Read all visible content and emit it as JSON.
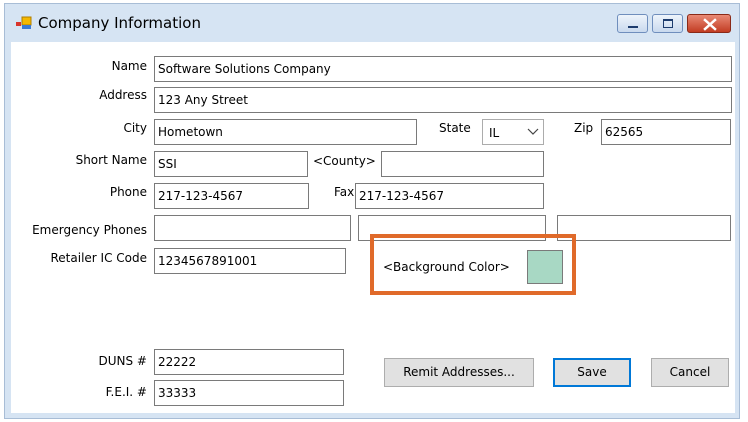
{
  "window": {
    "title": "Company Information",
    "icon": "form-app-icon",
    "controls": {
      "minimize": "minimize-icon",
      "maximize": "maximize-icon",
      "close": "close-icon"
    }
  },
  "form": {
    "name": {
      "label": "Name",
      "value": "Software Solutions Company"
    },
    "address": {
      "label": "Address",
      "value": "123 Any Street"
    },
    "city": {
      "label": "City",
      "value": "Hometown"
    },
    "state": {
      "label": "State",
      "value": "IL"
    },
    "zip": {
      "label": "Zip",
      "value": "62565"
    },
    "short_name": {
      "label": "Short Name",
      "value": "SSI"
    },
    "county": {
      "label": "<County>",
      "value": ""
    },
    "phone": {
      "label": "Phone",
      "value": "217-123-4567"
    },
    "fax": {
      "label": "Fax",
      "value": "217-123-4567"
    },
    "emergency_phones": {
      "label": "Emergency Phones",
      "values": [
        "",
        "",
        ""
      ]
    },
    "retailer_ic_code": {
      "label": "Retailer IC Code",
      "value": "1234567891001"
    },
    "background_color": {
      "label": "<Background Color>",
      "swatch": "#a8d8c4"
    },
    "duns": {
      "label": "DUNS #",
      "value": "22222"
    },
    "fei": {
      "label": "F.E.I. #",
      "value": "33333"
    }
  },
  "buttons": {
    "remit_addresses": "Remit Addresses...",
    "save": "Save",
    "cancel": "Cancel"
  },
  "colors": {
    "highlight": "#e06a2a",
    "frame": "#d6e4f3",
    "focus": "#0078d7"
  }
}
